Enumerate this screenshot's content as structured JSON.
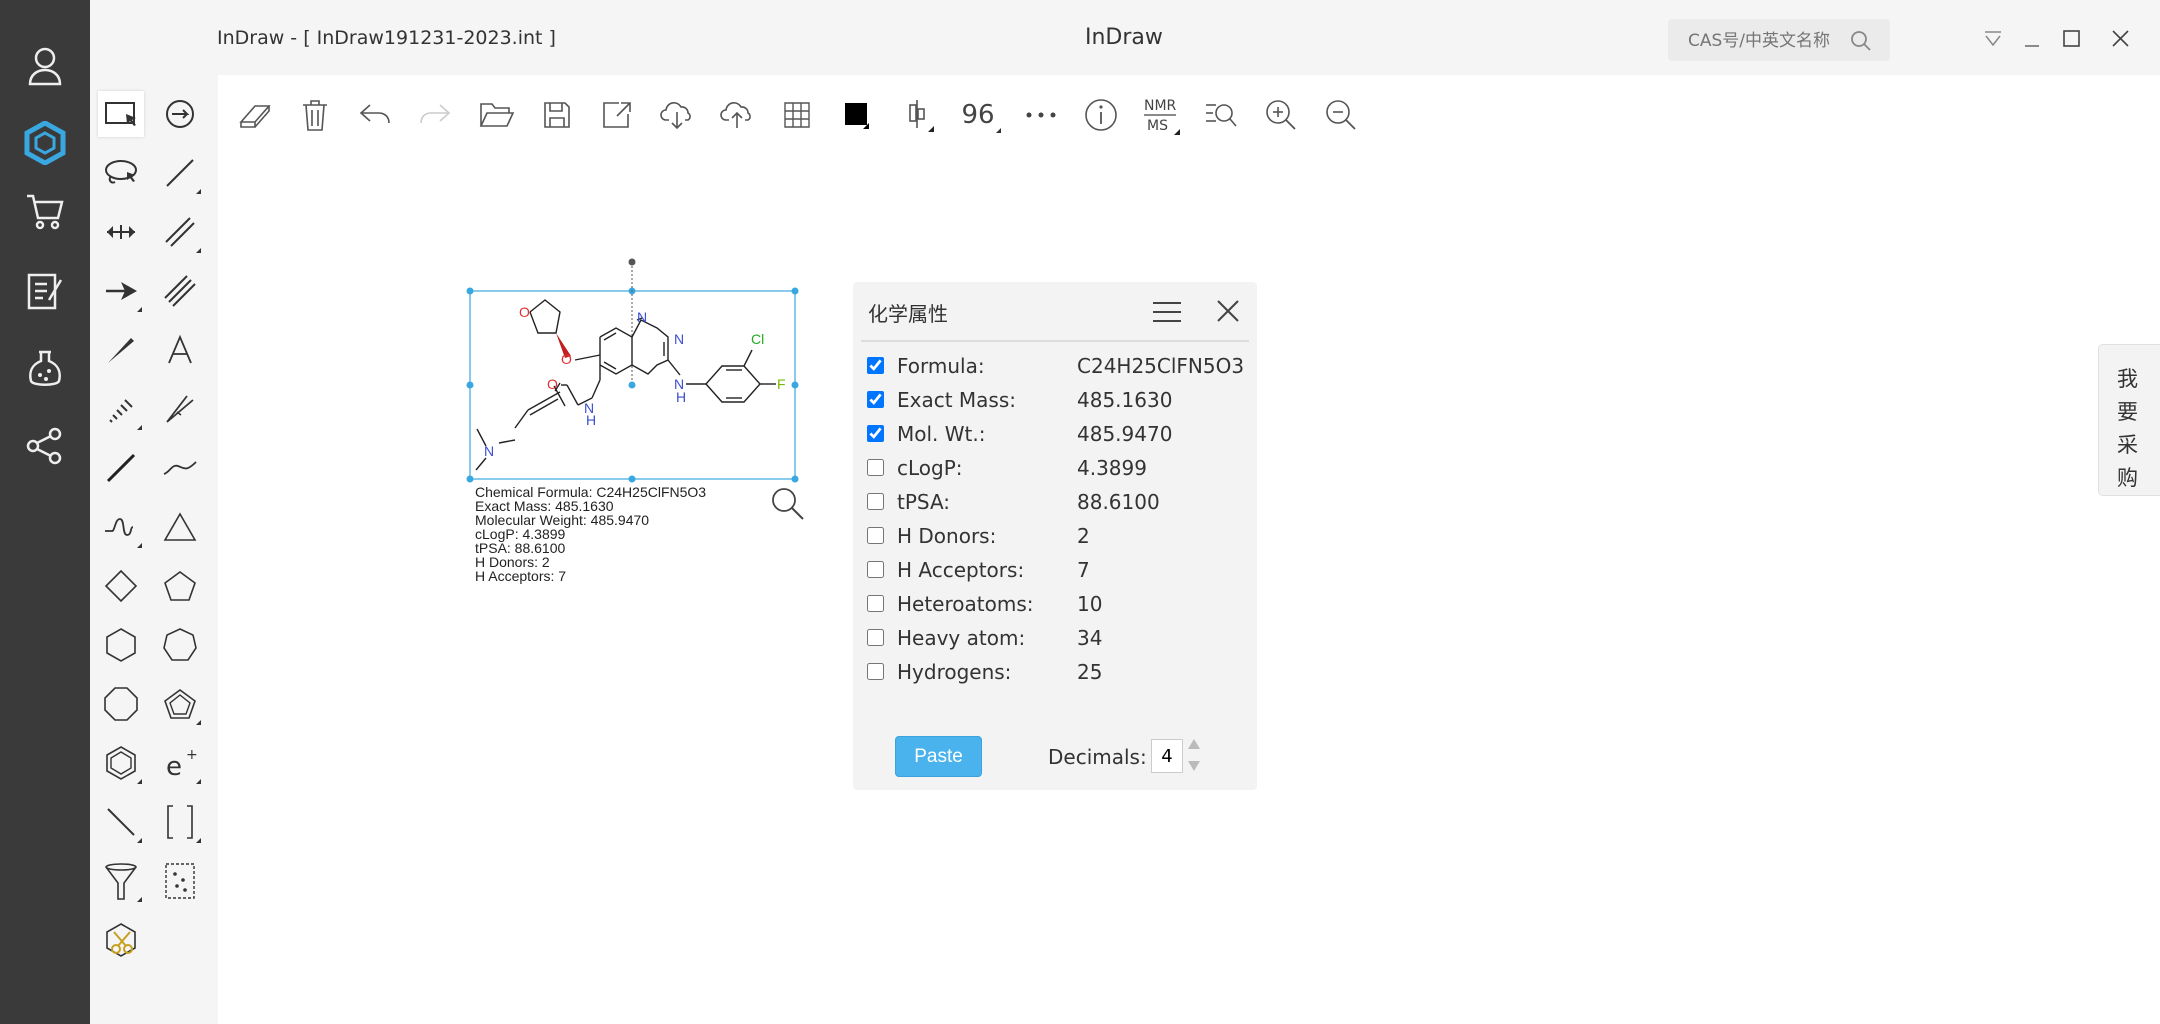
{
  "window": {
    "doc_title": "InDraw - [ InDraw191231-2023.int ]",
    "app_title": "InDraw"
  },
  "search": {
    "placeholder": "CAS号/中英文名称"
  },
  "toolbar": {
    "font_size": "96"
  },
  "sidebar": {
    "items": [
      {
        "icon": "user-icon"
      },
      {
        "icon": "indraw-logo-icon"
      },
      {
        "icon": "cart-icon"
      },
      {
        "icon": "notes-icon"
      },
      {
        "icon": "flask-icon"
      },
      {
        "icon": "share-network-icon"
      }
    ]
  },
  "molecule": {
    "atoms": {
      "O1": "O",
      "O2": "O",
      "O3": "O",
      "N1": "N",
      "N2": "N",
      "N3": "N",
      "N4": "N",
      "N5": "N",
      "H1": "H",
      "H2": "H",
      "Cl": "Cl",
      "F": "F"
    },
    "info": [
      "Chemical Formula: C24H25ClFN5O3",
      "Exact Mass: 485.1630",
      "Molecular Weight: 485.9470",
      "cLogP: 4.3899",
      "tPSA: 88.6100",
      "H Donors: 2",
      "H Acceptors: 7"
    ]
  },
  "panel": {
    "title": "化学属性",
    "properties": [
      {
        "label": "Formula:",
        "value": "C24H25ClFN5O3",
        "checked": true
      },
      {
        "label": "Exact Mass:",
        "value": "485.1630",
        "checked": true
      },
      {
        "label": "Mol. Wt.:",
        "value": "485.9470",
        "checked": true
      },
      {
        "label": "cLogP:",
        "value": "4.3899",
        "checked": false
      },
      {
        "label": "tPSA:",
        "value": "88.6100",
        "checked": false
      },
      {
        "label": "H Donors:",
        "value": "2",
        "checked": false
      },
      {
        "label": "H Acceptors:",
        "value": "7",
        "checked": false
      },
      {
        "label": "Heteroatoms:",
        "value": "10",
        "checked": false
      },
      {
        "label": "Heavy atom:",
        "value": "34",
        "checked": false
      },
      {
        "label": "Hydrogens:",
        "value": "25",
        "checked": false
      }
    ],
    "paste_label": "Paste",
    "decimals_label": "Decimals:",
    "decimals_value": "4"
  },
  "purchase_tab": {
    "label": "我要采购"
  },
  "colors": {
    "accent": "#4ab3ee",
    "sidebar_bg": "#3a3a3a",
    "selection": "#3aa8e0",
    "nitrogen": "#3b4fd1",
    "oxygen": "#e03030",
    "chlorine": "#22aa22",
    "fluorine": "#7ab800"
  }
}
